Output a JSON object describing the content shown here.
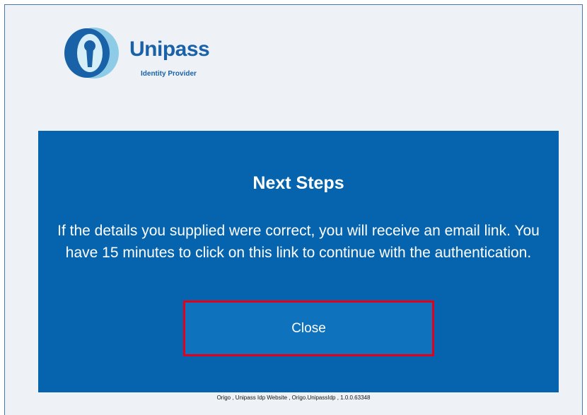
{
  "branding": {
    "name": "Unipass",
    "subtitle": "Identity Provider",
    "logo_icon": "unipass-keyhole-logo-icon",
    "primary_color": "#1a62a8",
    "accent_color": "#8ecbe6"
  },
  "panel": {
    "title": "Next Steps",
    "message": "If the details you supplied were correct, you will receive an email link. You have 15 minutes to click on this link to continue with the authentication.",
    "close_label": "Close",
    "background_color": "#0564ad",
    "highlight_color": "#e3001b"
  },
  "footer": {
    "text": "Origo , Unipass Idp Website , Origo.UnipassIdp , 1.0.0.63348"
  }
}
